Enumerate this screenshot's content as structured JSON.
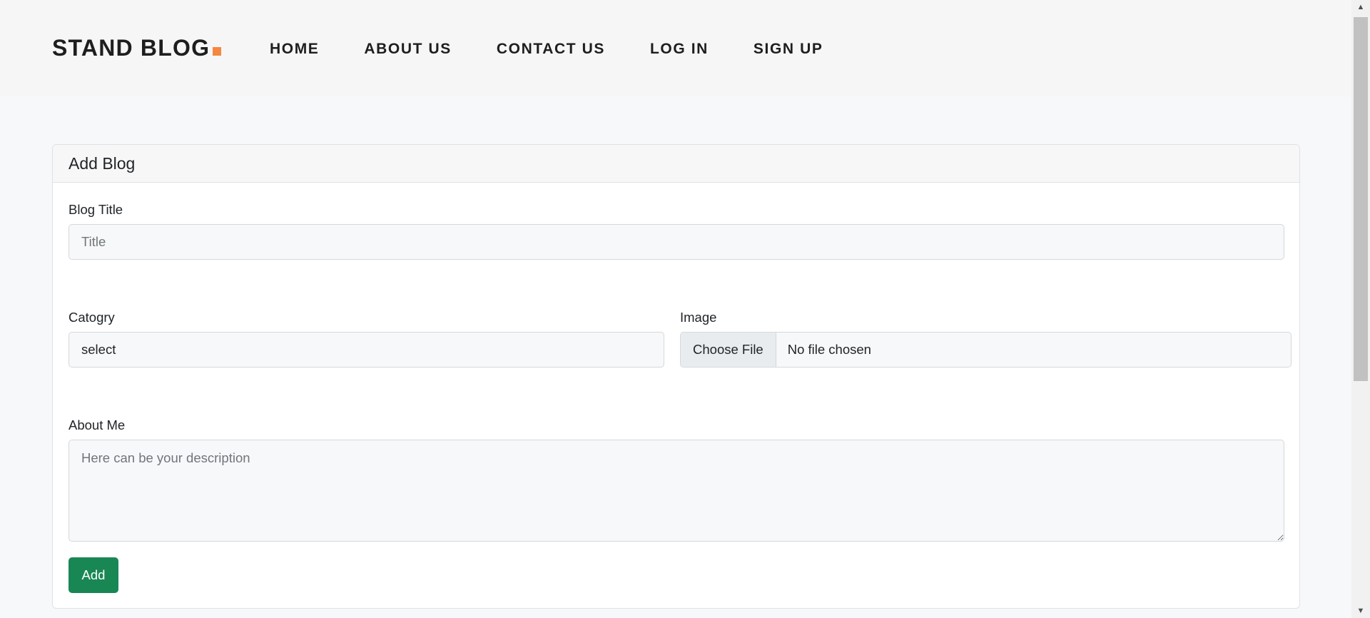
{
  "header": {
    "logo_text": "STAND BLOG",
    "logo_accent_color": "#f48840",
    "nav": [
      {
        "label": "HOME"
      },
      {
        "label": "ABOUT US"
      },
      {
        "label": "CONTACT US"
      },
      {
        "label": "LOG IN"
      },
      {
        "label": "SIGN UP"
      }
    ]
  },
  "form": {
    "card_title": "Add Blog",
    "title_label": "Blog Title",
    "title_placeholder": "Title",
    "title_value": "",
    "category_label": "Catogry",
    "category_selected": "select",
    "image_label": "Image",
    "file_button_label": "Choose File",
    "file_status": "No file chosen",
    "about_label": "About Me",
    "about_placeholder": "Here can be your description",
    "about_value": "",
    "submit_label": "Add",
    "submit_color": "#198754"
  },
  "scrollbar": {
    "up_icon": "chevron-up-icon",
    "down_icon": "chevron-down-icon"
  }
}
